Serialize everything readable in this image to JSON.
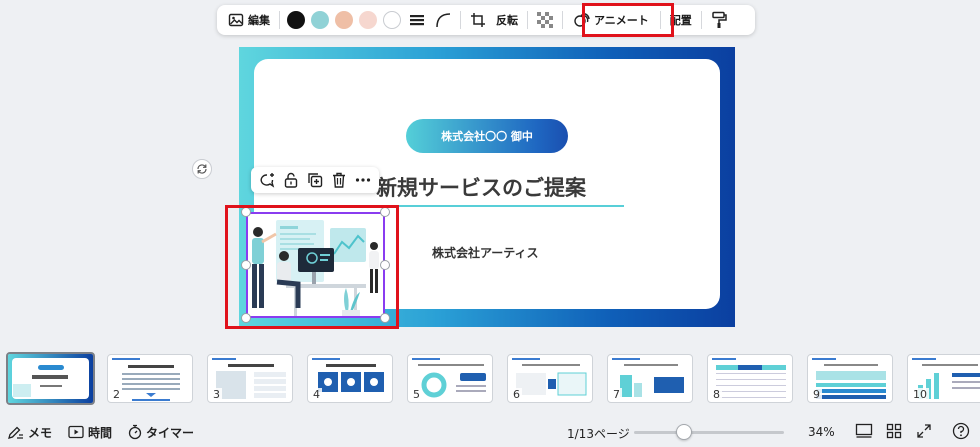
{
  "toolbar": {
    "edit_label": "編集",
    "flip_label": "反転",
    "animate_label": "アニメート",
    "arrange_label": "配置",
    "swatches": [
      "#111111",
      "#90d2d6",
      "#efbfa6",
      "#f6d7cf",
      "#ffffff"
    ]
  },
  "slide": {
    "pill_text": "株式会社〇〇 御中",
    "title": "新規サービスのご提案",
    "company": "株式会社アーティス"
  },
  "thumbnails": [
    {
      "num": "",
      "active": true
    },
    {
      "num": "2",
      "active": false
    },
    {
      "num": "3",
      "active": false
    },
    {
      "num": "4",
      "active": false
    },
    {
      "num": "5",
      "active": false
    },
    {
      "num": "6",
      "active": false
    },
    {
      "num": "7",
      "active": false
    },
    {
      "num": "8",
      "active": false
    },
    {
      "num": "9",
      "active": false
    },
    {
      "num": "10",
      "active": false
    }
  ],
  "bottombar": {
    "memo_label": "メモ",
    "time_label": "時間",
    "timer_label": "タイマー",
    "page_indicator": "1/13ページ",
    "zoom": "34%",
    "zoom_fraction": 0.33
  },
  "colors": {
    "highlight_red": "#e0121b",
    "selection_purple": "#8a3cf0",
    "accent_teal": "#58cfd8",
    "accent_blue": "#1f68c2"
  }
}
